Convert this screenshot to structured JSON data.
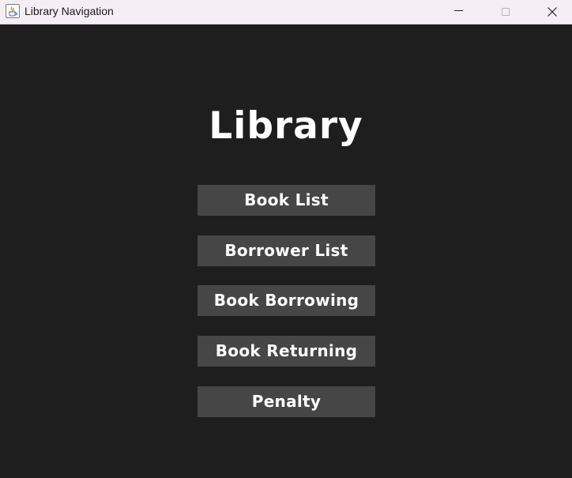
{
  "window": {
    "title": "Library Navigation",
    "app_icon": "java-coffee-cup-icon",
    "controls": {
      "minimize_icon": "minimize-icon",
      "maximize_icon": "maximize-icon",
      "close_icon": "close-icon"
    }
  },
  "main": {
    "heading": "Library",
    "buttons": [
      {
        "label": "Book List"
      },
      {
        "label": "Borrower List"
      },
      {
        "label": "Book Borrowing"
      },
      {
        "label": "Book Returning"
      },
      {
        "label": "Penalty"
      }
    ]
  },
  "colors": {
    "background": "#1e1e1e",
    "button_background": "#464646",
    "text": "#ffffff",
    "titlebar": "#f6eef5"
  }
}
